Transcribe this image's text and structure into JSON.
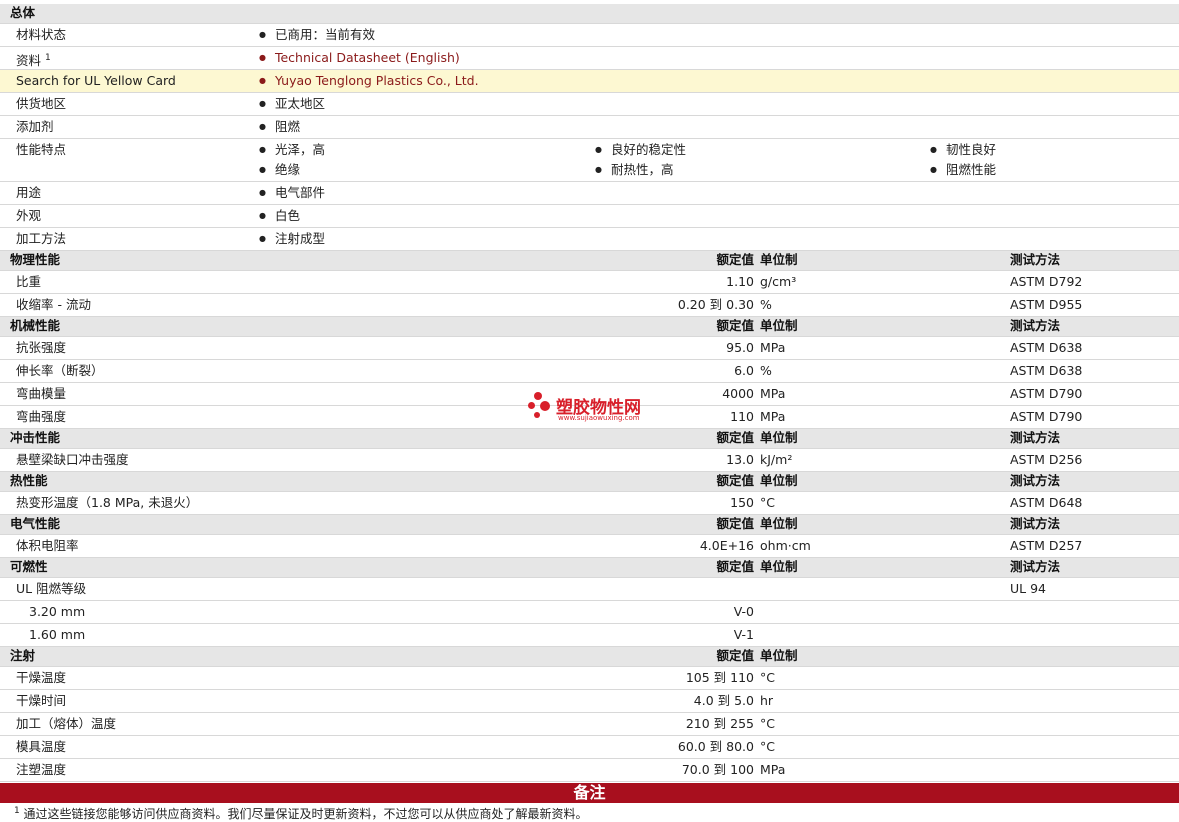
{
  "general": {
    "title": "总体",
    "rows": [
      {
        "label": "材料状态",
        "cols": [
          [
            "已商用：当前有效"
          ]
        ]
      },
      {
        "label": "资料",
        "sup": "1",
        "cols": [
          [
            "Technical Datasheet (English)"
          ]
        ],
        "link": true
      },
      {
        "label": "Search for UL Yellow Card",
        "cols": [
          [
            "Yuyao Tenglong Plastics Co., Ltd."
          ]
        ],
        "link": true,
        "highlight": true
      },
      {
        "label": "供货地区",
        "cols": [
          [
            "亚太地区"
          ]
        ]
      },
      {
        "label": "添加剂",
        "cols": [
          [
            "阻燃"
          ]
        ]
      },
      {
        "label": "性能特点",
        "cols": [
          [
            "光泽，高",
            "绝缘"
          ],
          [
            "良好的稳定性",
            "耐热性，高"
          ],
          [
            "韧性良好",
            "阻燃性能"
          ]
        ]
      },
      {
        "label": "用途",
        "cols": [
          [
            "电气部件"
          ]
        ]
      },
      {
        "label": "外观",
        "cols": [
          [
            "白色"
          ]
        ]
      },
      {
        "label": "加工方法",
        "cols": [
          [
            "注射成型"
          ]
        ]
      }
    ]
  },
  "headers": {
    "nominal": "额定值",
    "unit": "单位制",
    "test": "测试方法"
  },
  "sections": [
    {
      "title": "物理性能",
      "show_test": true,
      "rows": [
        {
          "label": "比重",
          "nominal": "1.10",
          "unit": "g/cm³",
          "test": "ASTM D792"
        },
        {
          "label": "收缩率 - 流动",
          "nominal": "0.20 到  0.30",
          "unit": "%",
          "test": "ASTM D955"
        }
      ]
    },
    {
      "title": "机械性能",
      "show_test": true,
      "rows": [
        {
          "label": "抗张强度",
          "nominal": "95.0",
          "unit": "MPa",
          "test": "ASTM D638"
        },
        {
          "label": "伸长率（断裂）",
          "nominal": "6.0",
          "unit": "%",
          "test": "ASTM D638"
        },
        {
          "label": "弯曲模量",
          "nominal": "4000",
          "unit": "MPa",
          "test": "ASTM D790"
        },
        {
          "label": "弯曲强度",
          "nominal": "110",
          "unit": "MPa",
          "test": "ASTM D790"
        }
      ]
    },
    {
      "title": "冲击性能",
      "show_test": true,
      "rows": [
        {
          "label": "悬壁梁缺口冲击强度",
          "nominal": "13.0",
          "unit": "kJ/m²",
          "test": "ASTM D256"
        }
      ]
    },
    {
      "title": "热性能",
      "show_test": true,
      "rows": [
        {
          "label": "热变形温度（1.8 MPa, 未退火）",
          "nominal": "150",
          "unit": "°C",
          "test": "ASTM D648"
        }
      ]
    },
    {
      "title": "电气性能",
      "show_test": true,
      "rows": [
        {
          "label": "体积电阻率",
          "nominal": "4.0E+16",
          "unit": "ohm·cm",
          "test": "ASTM D257"
        }
      ]
    },
    {
      "title": "可燃性",
      "show_test": true,
      "rows": [
        {
          "label": "UL 阻燃等级",
          "nominal": "",
          "unit": "",
          "test": "UL 94"
        },
        {
          "label": "3.20 mm",
          "nominal": "V-0",
          "unit": "",
          "test": "",
          "sub": true
        },
        {
          "label": "1.60 mm",
          "nominal": "V-1",
          "unit": "",
          "test": "",
          "sub": true
        }
      ]
    },
    {
      "title": "注射",
      "show_test": false,
      "rows": [
        {
          "label": "干燥温度",
          "nominal": "105 到  110",
          "unit": "°C",
          "test": ""
        },
        {
          "label": "干燥时间",
          "nominal": "4.0 到  5.0",
          "unit": "hr",
          "test": ""
        },
        {
          "label": "加工（熔体）温度",
          "nominal": "210 到  255",
          "unit": "°C",
          "test": ""
        },
        {
          "label": "模具温度",
          "nominal": "60.0 到  80.0",
          "unit": "°C",
          "test": ""
        },
        {
          "label": "注塑温度",
          "nominal": "70.0 到  100",
          "unit": "MPa",
          "test": ""
        }
      ]
    }
  ],
  "notes_title": "备注",
  "footnote": {
    "sup": "1",
    "text": "通过这些链接您能够访问供应商资料。我们尽量保证及时更新资料，不过您可以从供应商处了解最新资料。"
  },
  "watermark": {
    "name": "塑胶物性网",
    "url": "www.sujiaowuxing.com"
  },
  "colors": {
    "notes_bar": "#a80f1e",
    "link": "#8b1a1a",
    "highlight": "#fdf8d2",
    "section_bg": "#e6e6e6"
  }
}
